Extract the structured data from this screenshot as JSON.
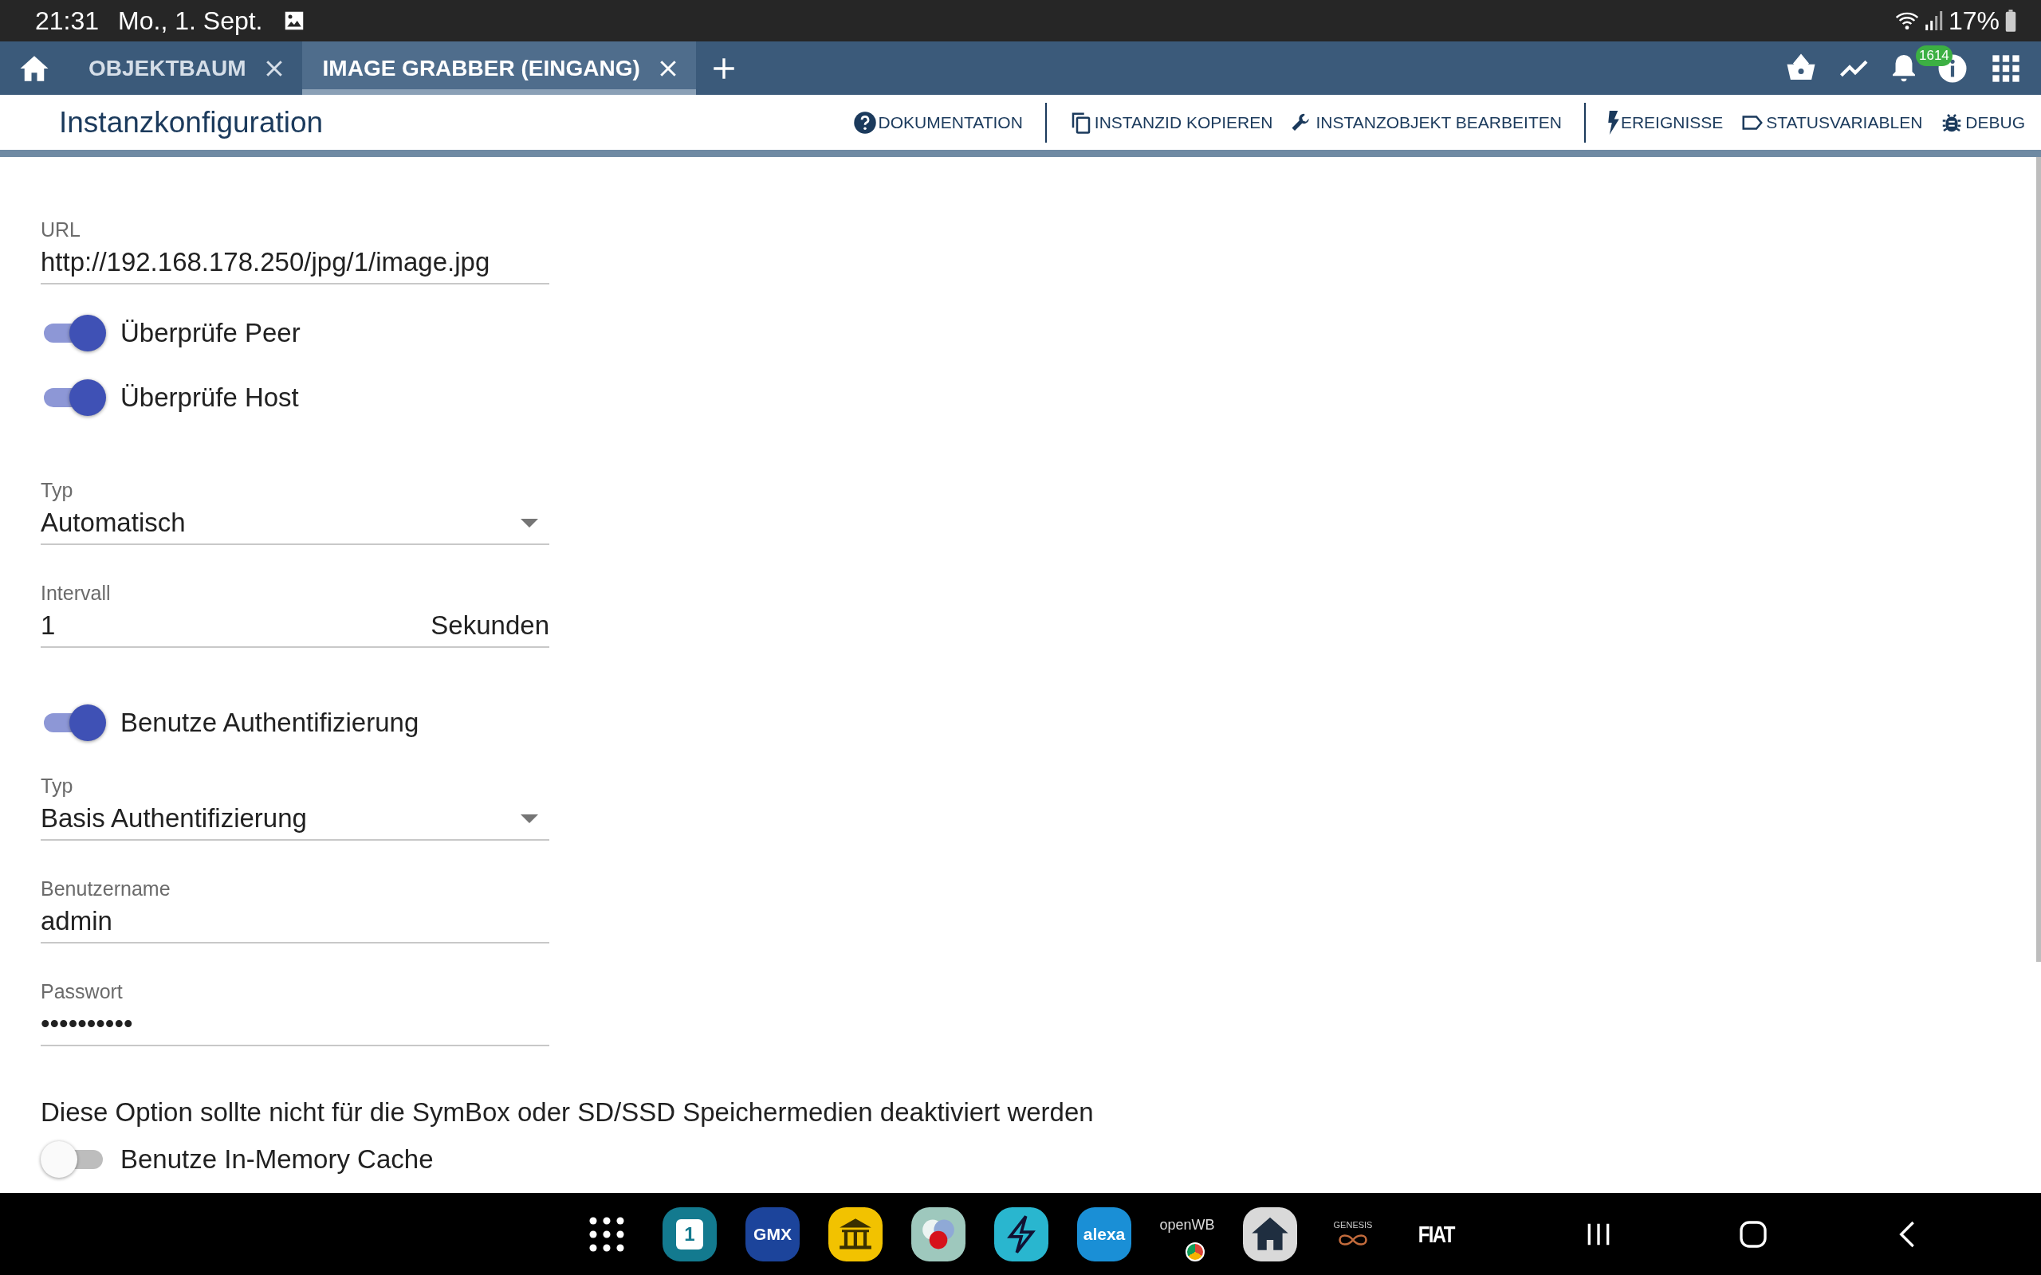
{
  "status_bar": {
    "time": "21:31",
    "date": "Mo., 1. Sept.",
    "battery": "17%"
  },
  "tabs": [
    {
      "label": "OBJEKTBAUM",
      "selected": false
    },
    {
      "label": "IMAGE GRABBER (EINGANG)",
      "selected": true
    }
  ],
  "notification_badge": "1614",
  "page_title": "Instanzkonfiguration",
  "toolbar": [
    {
      "label": "DOKUMENTATION",
      "kind": "help",
      "divider_before": false
    },
    {
      "label": "INSTANZID KOPIEREN",
      "kind": "copy",
      "divider_before": true
    },
    {
      "label": "INSTANZOBJEKT BEARBEITEN",
      "kind": "wrench",
      "divider_before": false
    },
    {
      "label": "EREIGNISSE",
      "kind": "bolt",
      "divider_before": true
    },
    {
      "label": "STATUSVARIABLEN",
      "kind": "tag",
      "divider_before": false
    },
    {
      "label": "DEBUG",
      "kind": "bug",
      "divider_before": false
    }
  ],
  "sections": [
    {
      "items": [
        {
          "kind": "text",
          "label": "URL",
          "value": "http://192.168.178.250/jpg/1/image.jpg"
        },
        {
          "kind": "toggle",
          "label": "Überprüfe Peer",
          "on": true
        },
        {
          "kind": "toggle",
          "label": "Überprüfe Host",
          "on": true
        }
      ]
    },
    {
      "items": [
        {
          "kind": "select",
          "label": "Typ",
          "value": "Automatisch"
        },
        {
          "kind": "number",
          "label": "Intervall",
          "value": "1",
          "suffix": "Sekunden"
        }
      ]
    },
    {
      "items": [
        {
          "kind": "toggle",
          "label": "Benutze Authentifizierung",
          "on": true
        },
        {
          "kind": "select",
          "label": "Typ",
          "value": "Basis Authentifizierung"
        },
        {
          "kind": "text",
          "label": "Benutzername",
          "value": "admin"
        },
        {
          "kind": "text",
          "label": "Passwort",
          "value": "••••••••••"
        }
      ]
    },
    {
      "items": [
        {
          "kind": "note",
          "text": "Diese Option sollte nicht für die SymBox oder SD/SSD Speichermedien deaktiviert werden"
        },
        {
          "kind": "toggle",
          "label": "Benutze In-Memory Cache",
          "on": false
        }
      ]
    }
  ],
  "dock": [
    {
      "kind": "apps"
    },
    {
      "kind": "calendar",
      "label": "1",
      "color": "#137a8f"
    },
    {
      "kind": "badge",
      "label": "GMX",
      "color": "#1c449b"
    },
    {
      "kind": "bank",
      "color": "#f2c200"
    },
    {
      "kind": "circles",
      "color": "#9ec8bd"
    },
    {
      "kind": "bolt",
      "color": "#29b6cf"
    },
    {
      "kind": "badge",
      "label": "alexa",
      "color": "#1a8fd6"
    },
    {
      "kind": "openwb",
      "label": "openWB",
      "color": "#000000"
    },
    {
      "kind": "home",
      "color": "#d9d9d9"
    },
    {
      "kind": "genesis",
      "label": "GENESIS",
      "color": "#000000"
    },
    {
      "kind": "fiat",
      "label": "FIAT",
      "color": "#000000"
    }
  ]
}
